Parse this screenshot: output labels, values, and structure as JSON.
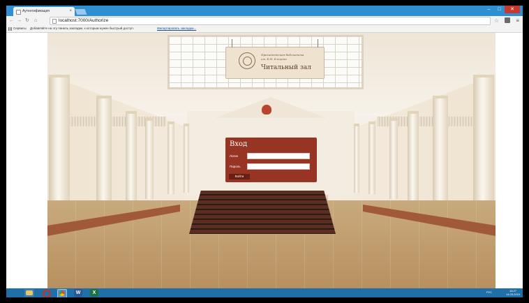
{
  "browser": {
    "tab_title": "Аутентификация",
    "tab_close": "×",
    "url": "localhost:7000/Authorize",
    "bookmarks": {
      "apps": "Сервисы",
      "hint": "Добавляйте на эту панель закладки, к которым нужен быстрый доступ.",
      "import": "Импортировать закладки..."
    },
    "window_controls": [
      "–",
      "□",
      "✕"
    ],
    "nav_icons": [
      "back-icon",
      "forward-icon",
      "reload-icon",
      "home-icon"
    ]
  },
  "hall_sign": {
    "line1": "Президентская библиотека",
    "line2": "им. Б.Н. Ельцина",
    "title": "Читальный зал"
  },
  "login_form": {
    "title": "Вход",
    "login_label": "Логин",
    "login_value": "",
    "password_label": "Пароль",
    "password_value": "",
    "submit_label": "Войти"
  },
  "taskbar": {
    "apps": [
      "file-explorer-icon",
      "opera-icon",
      "chrome-icon",
      "word-icon",
      "excel-icon"
    ],
    "word_letter": "W",
    "excel_letter": "X",
    "tray": {
      "language": "РУС",
      "time": "15:27",
      "date": "14.03.2015"
    }
  }
}
